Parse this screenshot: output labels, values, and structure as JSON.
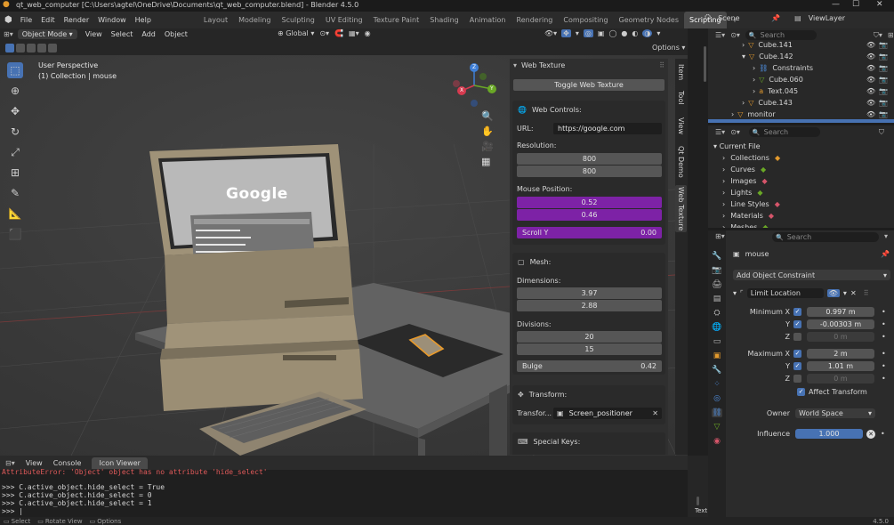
{
  "window": {
    "title": "qt_web_computer [C:\\Users\\agtel\\OneDrive\\Documents\\qt_web_computer.blend] - Blender 4.5.0",
    "min": "—",
    "max": "☐",
    "close": "✕"
  },
  "menus": [
    "File",
    "Edit",
    "Render",
    "Window",
    "Help"
  ],
  "workspaces": [
    "Layout",
    "Modeling",
    "Sculpting",
    "UV Editing",
    "Texture Paint",
    "Shading",
    "Animation",
    "Rendering",
    "Compositing",
    "Geometry Nodes",
    "Scripting"
  ],
  "active_workspace": "Scripting",
  "add_tab": "+",
  "scene": {
    "name": "Scene",
    "view_layer": "ViewLayer"
  },
  "viewport_header": {
    "mode": "Object Mode",
    "menus": [
      "View",
      "Select",
      "Add",
      "Object"
    ],
    "transform": "Global",
    "options": "Options"
  },
  "viewport": {
    "perspective": "User Perspective",
    "collection": "(1) Collection | mouse",
    "screen_text": "Google",
    "gizmo": {
      "x": "X",
      "y": "Y",
      "z": "Z"
    }
  },
  "web_panel": {
    "header": "Web Texture",
    "toggle": "Toggle Web Texture",
    "controls_title": "Web Controls:",
    "url_label": "URL:",
    "url": "https://google.com",
    "resolution_label": "Resolution:",
    "resolution": [
      "800",
      "800"
    ],
    "mouse_label": "Mouse Position:",
    "mouse": [
      "0.52",
      "0.46"
    ],
    "scroll_label": "Scroll Y",
    "scroll_value": "0.00",
    "mesh_title": "Mesh:",
    "dimensions_label": "Dimensions:",
    "dimensions": [
      "3.97",
      "2.88"
    ],
    "divisions_label": "Divisions:",
    "divisions": [
      "20",
      "15"
    ],
    "bulge_label": "Bulge",
    "bulge_value": "0.42",
    "transform_title": "Transform:",
    "transform_label": "Transfor...",
    "transform_value": "Screen_positioner",
    "special_title": "Special Keys:"
  },
  "side_tabs": [
    "Item",
    "Tool",
    "View",
    "Qt Demo",
    "Web Texture"
  ],
  "outliner": {
    "search": "Search",
    "items": [
      {
        "name": "Cube.141",
        "depth": 2
      },
      {
        "name": "Cube.142",
        "depth": 2
      },
      {
        "name": "Constraints",
        "depth": 3
      },
      {
        "name": "Cube.060",
        "depth": 3
      },
      {
        "name": "Text.045",
        "depth": 3
      },
      {
        "name": "Cube.143",
        "depth": 2
      },
      {
        "name": "monitor",
        "depth": 1
      }
    ]
  },
  "file_browser": {
    "search": "Search",
    "root": "Current File",
    "items": [
      "Collections",
      "Curves",
      "Images",
      "Lights",
      "Line Styles",
      "Materials",
      "Meshes"
    ]
  },
  "properties": {
    "search": "Search",
    "object": "mouse",
    "add_constraint": "Add Object Constraint",
    "constraint_name": "Limit Location",
    "min_label": "Minimum X",
    "min": [
      {
        "axis": "X",
        "value": "0.997 m",
        "on": true
      },
      {
        "axis": "Y",
        "value": "-0.00303 m",
        "on": true
      },
      {
        "axis": "Z",
        "value": "0 m",
        "on": false
      }
    ],
    "max_label": "Maximum X",
    "max": [
      {
        "axis": "X",
        "value": "2 m",
        "on": true
      },
      {
        "axis": "Y",
        "value": "1.01 m",
        "on": true
      },
      {
        "axis": "Z",
        "value": "0 m",
        "on": false
      }
    ],
    "affect_transform": "Affect Transform",
    "owner_label": "Owner",
    "owner_value": "World Space",
    "influence_label": "Influence",
    "influence_value": "1.000"
  },
  "console": {
    "menus": [
      "View",
      "Console"
    ],
    "active_tab": "Icon Viewer",
    "error_line": "AttributeError: 'Object' object has no attribute 'hide_select'",
    "lines": [
      ">>> C.active_object.hide_select = True",
      ">>> C.active_object.hide_select = 0",
      ">>> C.active_object.hide_select = 1",
      ">>> |"
    ],
    "side_tab": "Text"
  },
  "statusbar": {
    "select": "Select",
    "rotate": "Rotate View",
    "options": "Options",
    "version": "4.5.0"
  },
  "colors": {
    "accent": "#4772b3",
    "purple": "#7d22a6",
    "orange": "#e39a2d"
  }
}
